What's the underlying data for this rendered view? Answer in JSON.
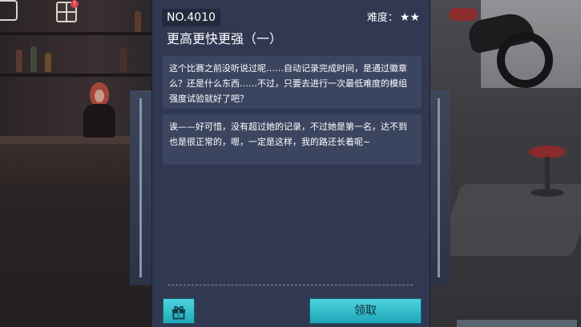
{
  "mission": {
    "number": "NO.4010",
    "difficulty_label": "难度：",
    "difficulty_stars": "★★",
    "title": "更高更快更强（一）",
    "dialogue": [
      "这个比赛之前没听说过呢……自动记录完成时间，是通过徽章么？还是什么东西……不过，只要去进行一次最低难度的模组强度试验就好了吧？",
      "诶——好可惜，没有超过她的记录，不过她是第一名，达不到也是很正常的，嗯，一定是这样，我的路还长着呢~"
    ]
  },
  "actions": {
    "gift_icon": "gift-icon",
    "claim_label": "领取"
  },
  "colors": {
    "panel": "#303852",
    "text_box": "#3c4560",
    "accent_button": "#2ebecc"
  }
}
